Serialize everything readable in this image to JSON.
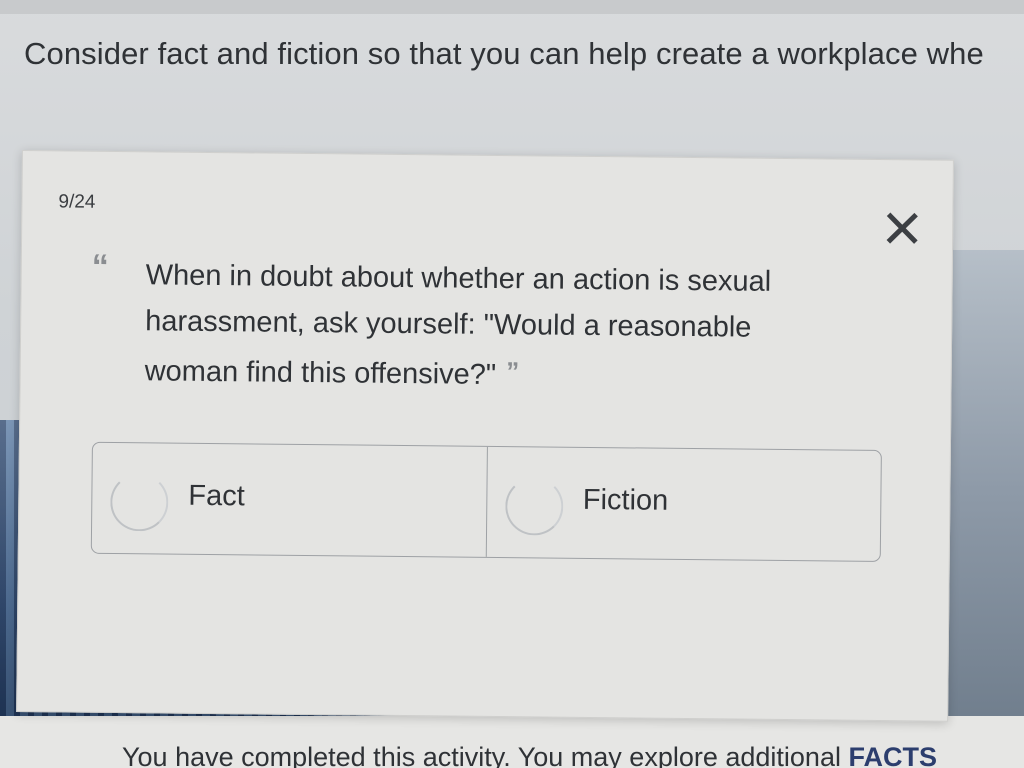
{
  "header": {
    "intro": "Consider fact and fiction so that you can help create a workplace whe"
  },
  "card": {
    "counter": "9/24",
    "close_label": "✕",
    "open_quote": "“",
    "close_quote": "”",
    "statement": "When in doubt about whether an action is sexual harassment, ask yourself: \"Would a reasonable woman find this offensive?\"",
    "options": [
      {
        "label": "Fact",
        "selected": false
      },
      {
        "label": "Fiction",
        "selected": false
      }
    ]
  },
  "footer": {
    "completion_text": "You have completed this activity. You may explore additional ",
    "facts_link": "FACTS"
  },
  "colors": {
    "card_background": "#e4e4e2",
    "text": "#2f3236",
    "quote_mark": "#8a8d91",
    "border": "#9ea1a5"
  }
}
